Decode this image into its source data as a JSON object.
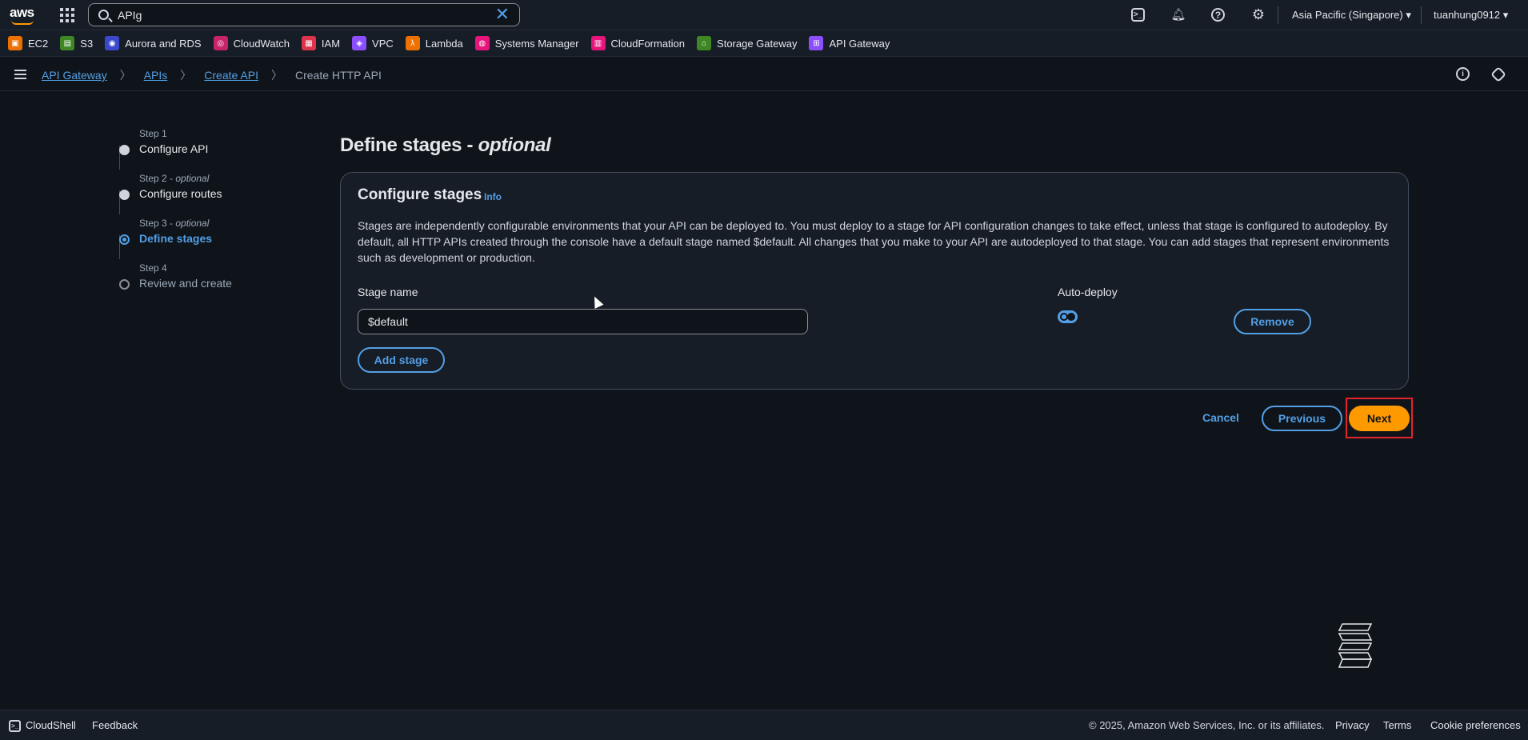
{
  "topnav": {
    "logo_text": "aws",
    "search_value": "APIg",
    "region": "Asia Pacific (Singapore) ▾",
    "user": "tuanhung0912 ▾",
    "icons": [
      "cloudshell-icon",
      "bell-icon",
      "help-icon",
      "gear-icon"
    ]
  },
  "favorites": [
    {
      "label": "EC2",
      "color": "#ed7100",
      "glyph": "▣"
    },
    {
      "label": "S3",
      "color": "#3f8624",
      "glyph": "▤"
    },
    {
      "label": "Aurora and RDS",
      "color": "#3b48cc",
      "glyph": "◉"
    },
    {
      "label": "CloudWatch",
      "color": "#c7236b",
      "glyph": "◎"
    },
    {
      "label": "IAM",
      "color": "#dd344c",
      "glyph": "▦"
    },
    {
      "label": "VPC",
      "color": "#8c4fff",
      "glyph": "◈"
    },
    {
      "label": "Lambda",
      "color": "#ed7100",
      "glyph": "λ"
    },
    {
      "label": "Systems Manager",
      "color": "#e7157b",
      "glyph": "◍"
    },
    {
      "label": "CloudFormation",
      "color": "#e7157b",
      "glyph": "▥"
    },
    {
      "label": "Storage Gateway",
      "color": "#3f8624",
      "glyph": "⌂"
    },
    {
      "label": "API Gateway",
      "color": "#8c4fff",
      "glyph": "⊞"
    }
  ],
  "breadcrumb": {
    "items": [
      "API Gateway",
      "APIs",
      "Create API"
    ],
    "current": "Create HTTP API"
  },
  "steps": [
    {
      "label": "Step 1",
      "optional": "",
      "name": "Configure API"
    },
    {
      "label": "Step 2 - ",
      "optional": "optional",
      "name": "Configure routes"
    },
    {
      "label": "Step 3 - ",
      "optional": "optional",
      "name": "Define stages"
    },
    {
      "label": "Step 4",
      "optional": "",
      "name": "Review and create"
    }
  ],
  "main": {
    "title": "Define stages - ",
    "title_optional": "optional",
    "card_title": "Configure stages",
    "info": "Info",
    "description": "Stages are independently configurable environments that your API can be deployed to. You must deploy to a stage for API configuration changes to take effect, unless that stage is configured to autodeploy. By default, all HTTP APIs created through the console have a default stage named $default. All changes that you make to your API are autodeployed to that stage. You can add stages that represent environments such as development or production.",
    "stage_name_label": "Stage name",
    "stage_name_value": "$default",
    "auto_deploy_label": "Auto-deploy",
    "remove": "Remove",
    "add_stage": "Add stage",
    "cancel": "Cancel",
    "previous": "Previous",
    "next": "Next"
  },
  "footer": {
    "cloudshell": "CloudShell",
    "feedback": "Feedback",
    "copyright": "© 2025, Amazon Web Services, Inc. or its affiliates.",
    "privacy": "Privacy",
    "terms": "Terms",
    "cookie": "Cookie preferences"
  }
}
